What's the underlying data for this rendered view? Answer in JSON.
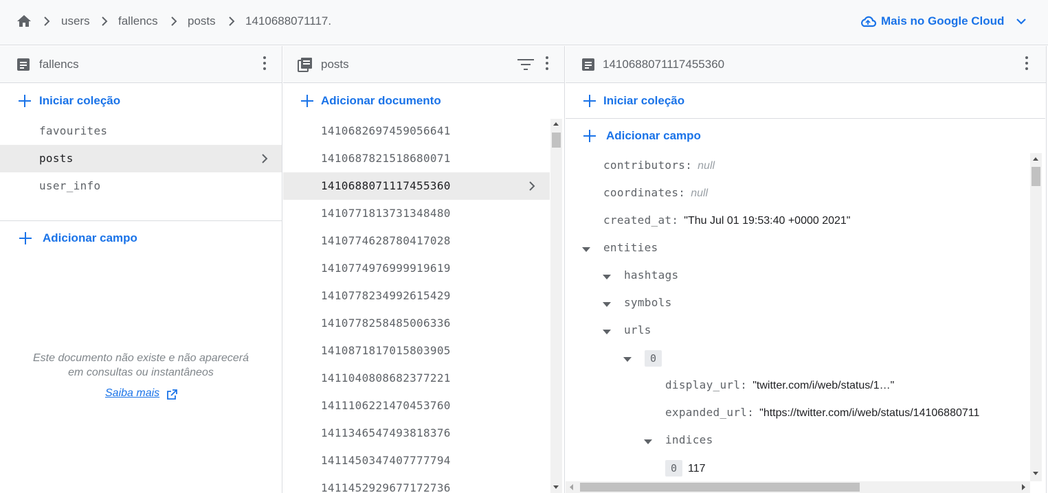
{
  "breadcrumb": {
    "items": [
      "users",
      "fallencs",
      "posts",
      "1410688071117."
    ],
    "cloud_label": "Mais no Google Cloud"
  },
  "panel1": {
    "title": "fallencs",
    "start_collection": "Iniciar coleção",
    "collections": [
      "favourites",
      "posts",
      "user_info"
    ],
    "add_field": "Adicionar campo",
    "empty_message": "Este documento não existe e não aparecerá em consultas ou instantâneos",
    "learn_more": "Saiba mais"
  },
  "panel2": {
    "title": "posts",
    "add_document": "Adicionar documento",
    "documents": [
      "1410682697459056641",
      "1410687821518680071",
      "1410688071117455360",
      "1410771813731348480",
      "1410774628780417028",
      "1410774976999919619",
      "1410778234992615429",
      "1410778258485006336",
      "1410871817015803905",
      "1411040808682377221",
      "1411106221470453760",
      "1411346547493818376",
      "1411450347407777794",
      "1411452929677172736"
    ]
  },
  "panel3": {
    "title": "1410688071117455360",
    "start_collection": "Iniciar coleção",
    "add_field": "Adicionar campo",
    "fields": {
      "contributors_key": "contributors:",
      "contributors_val": "null",
      "coordinates_key": "coordinates:",
      "coordinates_val": "null",
      "created_at_key": "created_at:",
      "created_at_val": "\"Thu Jul 01 19:53:40 +0000 2021\"",
      "entities_key": "entities",
      "hashtags_key": "hashtags",
      "symbols_key": "symbols",
      "urls_key": "urls",
      "index0": "0",
      "display_url_key": "display_url:",
      "display_url_val": "\"twitter.com/i/web/status/1…\"",
      "expanded_url_key": "expanded_url:",
      "expanded_url_val": "\"https://twitter.com/i/web/status/14106880711",
      "indices_key": "indices",
      "indices_0_idx": "0",
      "indices_0_val": "117"
    }
  }
}
